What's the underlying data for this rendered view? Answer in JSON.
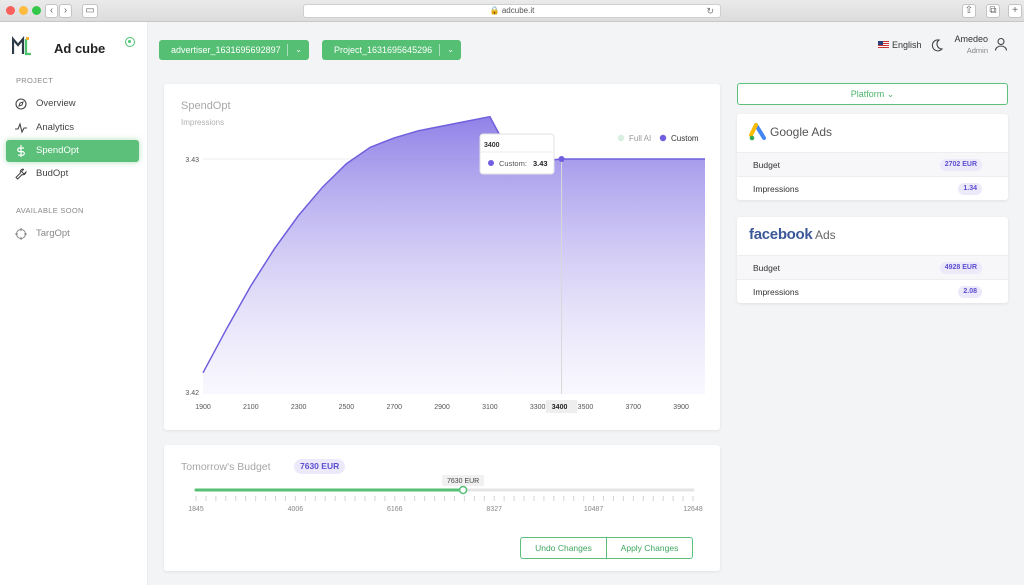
{
  "browser": {
    "url": "adcube.it"
  },
  "app": {
    "name": "Ad cube"
  },
  "sidebar": {
    "project_label": "PROJECT",
    "items": [
      {
        "label": "Overview",
        "icon": "compass-icon"
      },
      {
        "label": "Analytics",
        "icon": "activity-icon"
      },
      {
        "label": "SpendOpt",
        "icon": "dollar-icon",
        "active": true
      },
      {
        "label": "BudOpt",
        "icon": "wrench-icon"
      }
    ],
    "soon_label": "AVAILABLE SOON",
    "soon_items": [
      {
        "label": "TargOpt",
        "icon": "crosshair-icon"
      }
    ]
  },
  "header": {
    "advertiser": "advertiser_1631695692897",
    "project": "Project_1631695645296",
    "language": "English",
    "user_name": "Amedeo",
    "user_role": "Admin"
  },
  "chart": {
    "title": "SpendOpt",
    "subtitle": "Impressions",
    "legend": [
      "Full AI",
      "Custom"
    ],
    "tooltip_title": "3400",
    "tooltip_label": "Custom:",
    "tooltip_value": "3.43",
    "crosshair_label": "3400"
  },
  "chart_data": {
    "type": "area",
    "x_ticks": [
      1900,
      2100,
      2300,
      2500,
      2700,
      2900,
      3100,
      3300,
      3500,
      3700,
      3900
    ],
    "y_ticks": [
      "3.43",
      "3.42"
    ],
    "legend_position": "top-right",
    "series": [
      {
        "name": "Full AI",
        "color": "#d8efe0",
        "values": []
      },
      {
        "name": "Custom",
        "color": "#6f5fde",
        "x": [
          1900,
          2000,
          2100,
          2200,
          2300,
          2400,
          2500,
          2600,
          2700,
          2800,
          2900,
          3000,
          3100,
          3200,
          3300,
          3400,
          3500,
          3600,
          3700,
          3800,
          3900,
          4000
        ],
        "y": [
          3.4209,
          3.4228,
          3.4246,
          3.4262,
          3.4276,
          3.4288,
          3.4298,
          3.4305,
          3.4309,
          3.4312,
          3.4314,
          3.4316,
          3.4318,
          3.4299,
          3.4299,
          3.43,
          3.43,
          3.43,
          3.43,
          3.43,
          3.43,
          3.43
        ]
      }
    ],
    "xlim": [
      1900,
      4000
    ],
    "ylim": [
      3.42,
      3.43
    ]
  },
  "platform": {
    "label": "Platform"
  },
  "google": {
    "brand": "Google Ads",
    "rows": [
      {
        "label": "Budget",
        "value": "2702 EUR"
      },
      {
        "label": "Impressions",
        "value": "1.34"
      }
    ]
  },
  "facebook": {
    "brand_word": "facebook",
    "brand_suffix": "Ads",
    "rows": [
      {
        "label": "Budget",
        "value": "4928 EUR"
      },
      {
        "label": "Impressions",
        "value": "2.08"
      }
    ]
  },
  "budget": {
    "title": "Tomorrow's Budget",
    "value": "7630 EUR",
    "slider_label": "7630 EUR",
    "slider_fraction": 0.5374,
    "ticks": [
      "1845",
      "4006",
      "6166",
      "8327",
      "10487",
      "12648"
    ],
    "undo_label": "Undo Changes",
    "apply_label": "Apply Changes"
  }
}
